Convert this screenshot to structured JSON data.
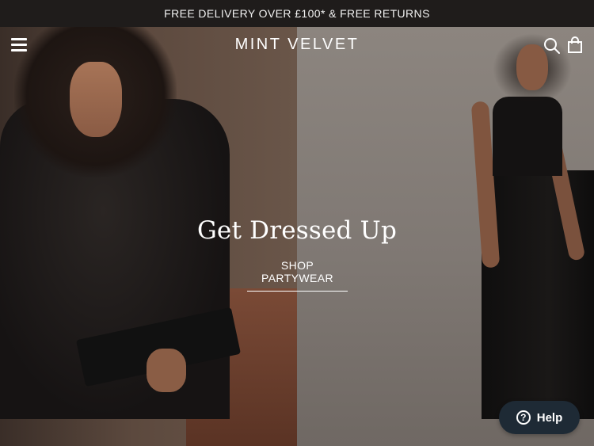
{
  "promo": {
    "text": "FREE DELIVERY OVER £100* & FREE RETURNS"
  },
  "header": {
    "logo": "MINT VELVET",
    "menu_icon": "hamburger-menu-icon",
    "search_icon": "search-icon",
    "bag_icon": "shopping-bag-icon"
  },
  "hero": {
    "title": "Get Dressed Up",
    "cta_label": "SHOP PARTYWEAR"
  },
  "help": {
    "label": "Help",
    "icon_glyph": "?"
  },
  "colors": {
    "promo_bg": "#1f1c1b",
    "help_bg": "#1e2a35",
    "text": "#ffffff"
  }
}
